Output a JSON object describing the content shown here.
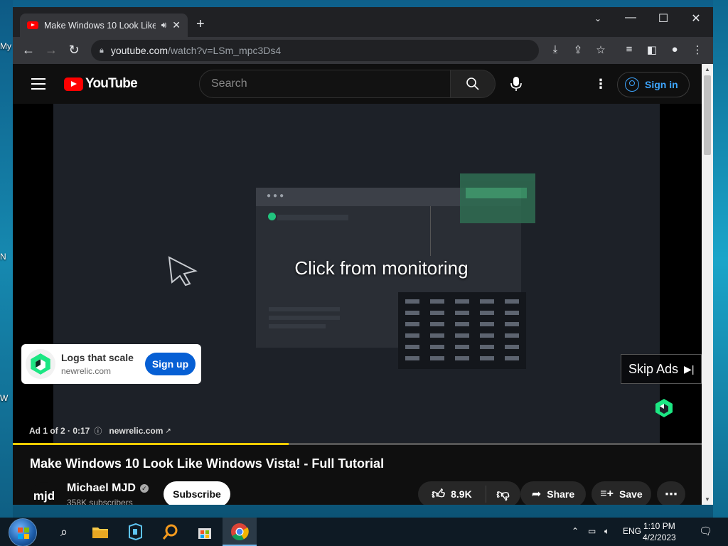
{
  "desktop": {
    "labels": [
      "My",
      "N",
      "W"
    ]
  },
  "browser": {
    "tab": {
      "title": "Make Windows 10 Look Like"
    },
    "url_host": "youtube.com",
    "url_path": "/watch?v=LSm_mpc3Ds4"
  },
  "youtube": {
    "logo_text": "YouTube",
    "search_placeholder": "Search",
    "signin_label": "Sign in",
    "ad": {
      "headline": "Click from monitoring",
      "card_title": "Logs that scale",
      "card_domain": "newrelic.com",
      "card_cta": "Sign up",
      "skip_label": "Skip Ads",
      "meta_count": "Ad 1 of 2 · 0:17",
      "meta_domain": "newrelic.com",
      "progress": 0.4
    },
    "video": {
      "title": "Make Windows 10 Look Like Windows Vista! - Full Tutorial",
      "channel_avatar_text": "mjd",
      "channel_name": "Michael MJD",
      "subscribers": "358K subscribers",
      "subscribe_label": "Subscribe",
      "likes": "8.9K",
      "share_label": "Share",
      "save_label": "Save"
    }
  },
  "taskbar": {
    "language": "ENG",
    "time": "1:10 PM",
    "date": "4/2/2023"
  },
  "colors": {
    "yt_red": "#ff0000",
    "link_blue": "#3ea6ff",
    "cta_blue": "#065fd4",
    "ad_progress": "#ffcc00",
    "newrelic_green": "#1ce783"
  }
}
